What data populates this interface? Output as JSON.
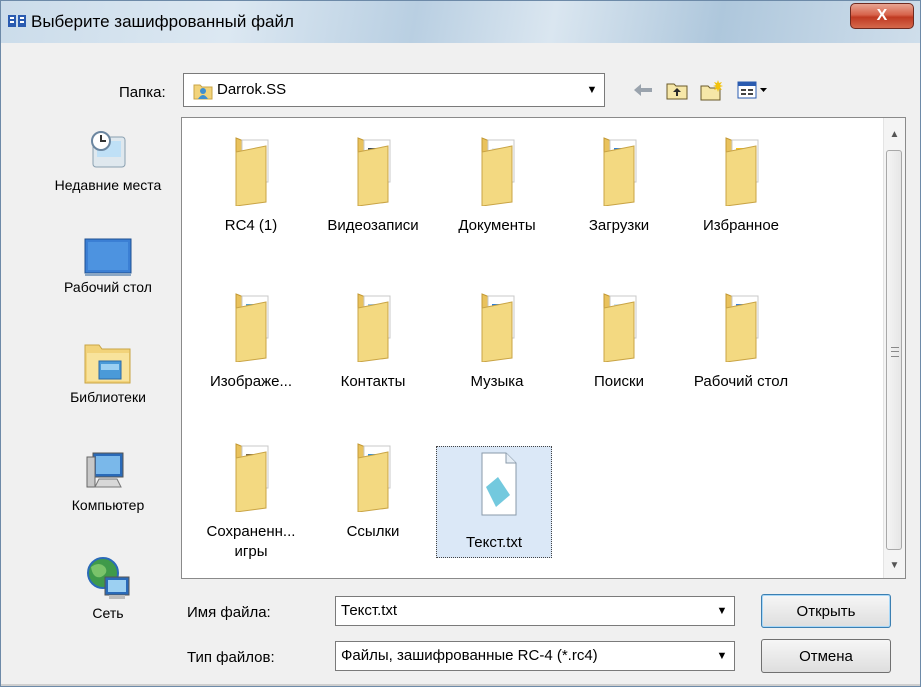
{
  "window": {
    "title": "Выберите зашифрованный файл",
    "close_glyph": "X"
  },
  "location": {
    "label": "Папка:",
    "current_folder": "Darrok.SS"
  },
  "toolbar": {
    "back_icon": "back-arrow-icon",
    "up_icon": "folder-up-icon",
    "new_folder_icon": "new-folder-icon",
    "view_menu_icon": "view-menu-icon"
  },
  "places": [
    {
      "label": "Недавние места",
      "icon": "recent-places-icon"
    },
    {
      "label": "Рабочий стол",
      "icon": "desktop-icon"
    },
    {
      "label": "Библиотеки",
      "icon": "libraries-icon"
    },
    {
      "label": "Компьютер",
      "icon": "computer-icon"
    },
    {
      "label": "Сеть",
      "icon": "network-icon"
    }
  ],
  "files": [
    {
      "label": "RC4 (1)",
      "icon": "folder-icon"
    },
    {
      "label": "Видеозаписи",
      "icon": "videos-folder-icon"
    },
    {
      "label": "Документы",
      "icon": "documents-folder-icon"
    },
    {
      "label": "Загрузки",
      "icon": "downloads-folder-icon"
    },
    {
      "label": "Избранное",
      "icon": "favorites-folder-icon"
    },
    {
      "label": "Изображе...",
      "icon": "pictures-folder-icon"
    },
    {
      "label": "Контакты",
      "icon": "contacts-folder-icon"
    },
    {
      "label": "Музыка",
      "icon": "music-folder-icon"
    },
    {
      "label": "Поиски",
      "icon": "searches-folder-icon"
    },
    {
      "label": "Рабочий стол",
      "icon": "desktop-folder-icon"
    },
    {
      "label": "Сохраненн... игры",
      "icon": "saved-games-folder-icon"
    },
    {
      "label": "Ссылки",
      "icon": "links-folder-icon"
    },
    {
      "label": "Текст.txt",
      "icon": "text-file-icon",
      "selected": true
    }
  ],
  "filename": {
    "label": "Имя файла:",
    "value": "Текст.txt"
  },
  "filetype": {
    "label": "Тип файлов:",
    "value": "Файлы, зашифрованные RC-4 (*.rc4)"
  },
  "buttons": {
    "open": "Открыть",
    "cancel": "Отмена"
  },
  "colors": {
    "folder": "#f2d37a",
    "close_red": "#c9432a",
    "selection": "#dbe8f7"
  }
}
